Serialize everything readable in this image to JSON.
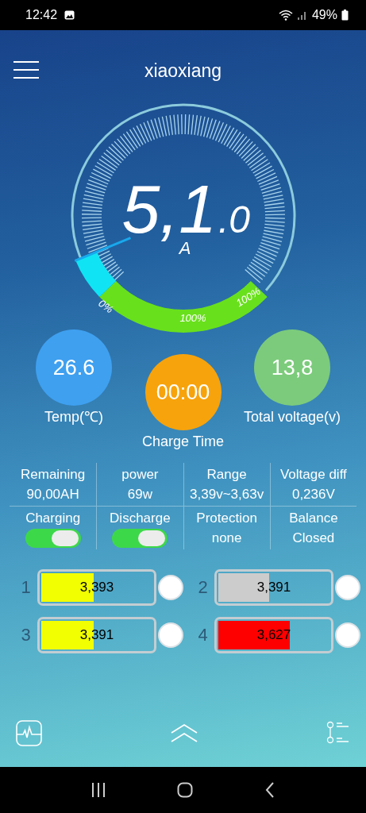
{
  "status_bar": {
    "time": "12:42",
    "battery": "49%"
  },
  "header": {
    "title": "xiaoxiang"
  },
  "gauge": {
    "value": "5,1",
    "decimal": ".0",
    "unit": "A",
    "labels": [
      "0%",
      "100%",
      "100%"
    ]
  },
  "indicators": [
    {
      "value": "26.6",
      "label": "Temp(℃)",
      "color": "#3fa0f0"
    },
    {
      "value": "00:00",
      "label": "Charge Time",
      "color": "#f7a30c"
    },
    {
      "value": "13,8",
      "label": "Total voltage(v)",
      "color": "#7ccb7c"
    }
  ],
  "stats": [
    {
      "label": "Remaining",
      "value": "90,00AH"
    },
    {
      "label": "power",
      "value": "69w"
    },
    {
      "label": "Range",
      "value": "3,39v~3,63v"
    },
    {
      "label": "Voltage diff",
      "value": "0,236V"
    }
  ],
  "controls": [
    {
      "kind": "toggle",
      "label": "Charging",
      "on": true
    },
    {
      "kind": "toggle",
      "label": "Discharge",
      "on": true
    },
    {
      "kind": "text",
      "label": "Protection",
      "value": "none"
    },
    {
      "kind": "text",
      "label": "Balance",
      "value": "Closed"
    }
  ],
  "cells": [
    {
      "index": "1",
      "reading": "3,393",
      "level": 0.47,
      "color": "#f2ff00"
    },
    {
      "index": "2",
      "reading": "3,391",
      "level": 0.46,
      "color": "#cccccc"
    },
    {
      "index": "3",
      "reading": "3,391",
      "level": 0.47,
      "color": "#f2ff00"
    },
    {
      "index": "4",
      "reading": "3,627",
      "level": 0.64,
      "color": "#ff0000"
    }
  ]
}
